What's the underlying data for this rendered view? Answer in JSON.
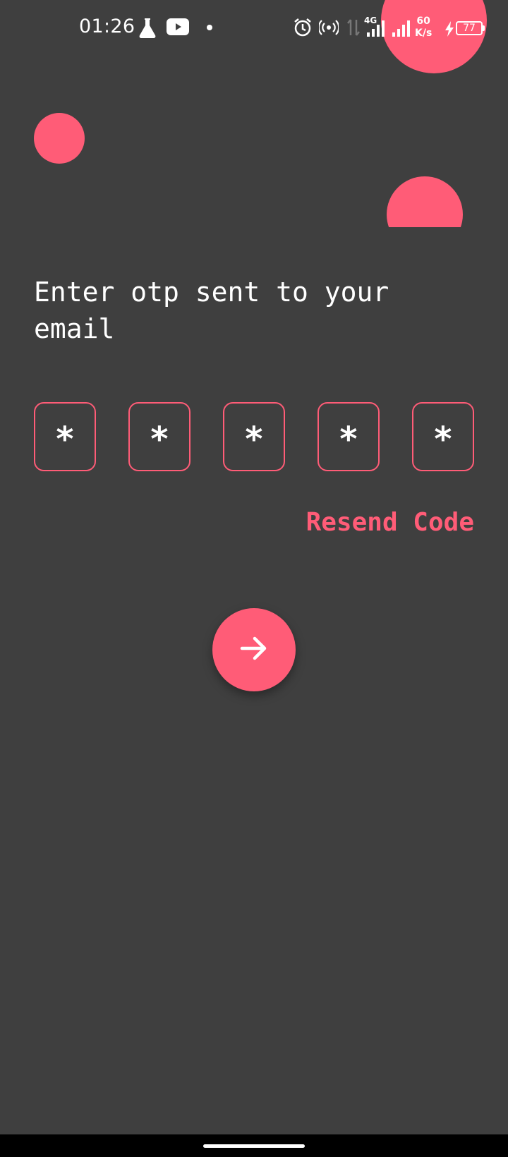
{
  "status_bar": {
    "time": "01:26",
    "network_type": "4G",
    "net_speed_value": "60",
    "net_speed_unit": "K/s",
    "battery_level": "77",
    "icons": [
      "flask-icon",
      "youtube-icon",
      "notification-dot-icon",
      "alarm-icon",
      "hotspot-icon",
      "data-transfer-icon",
      "signal-icon",
      "signal-icon-2",
      "charging-bolt-icon",
      "battery-icon"
    ]
  },
  "otp_screen": {
    "heading": "Enter otp sent to your email",
    "digits": [
      "*",
      "*",
      "*",
      "*",
      "*"
    ],
    "resend_label": "Resend Code",
    "next_icon": "arrow-right-icon"
  },
  "colors": {
    "background": "#3f3f3f",
    "accent": "#ff5c77",
    "text": "#ffffff",
    "navbar": "#000000"
  }
}
